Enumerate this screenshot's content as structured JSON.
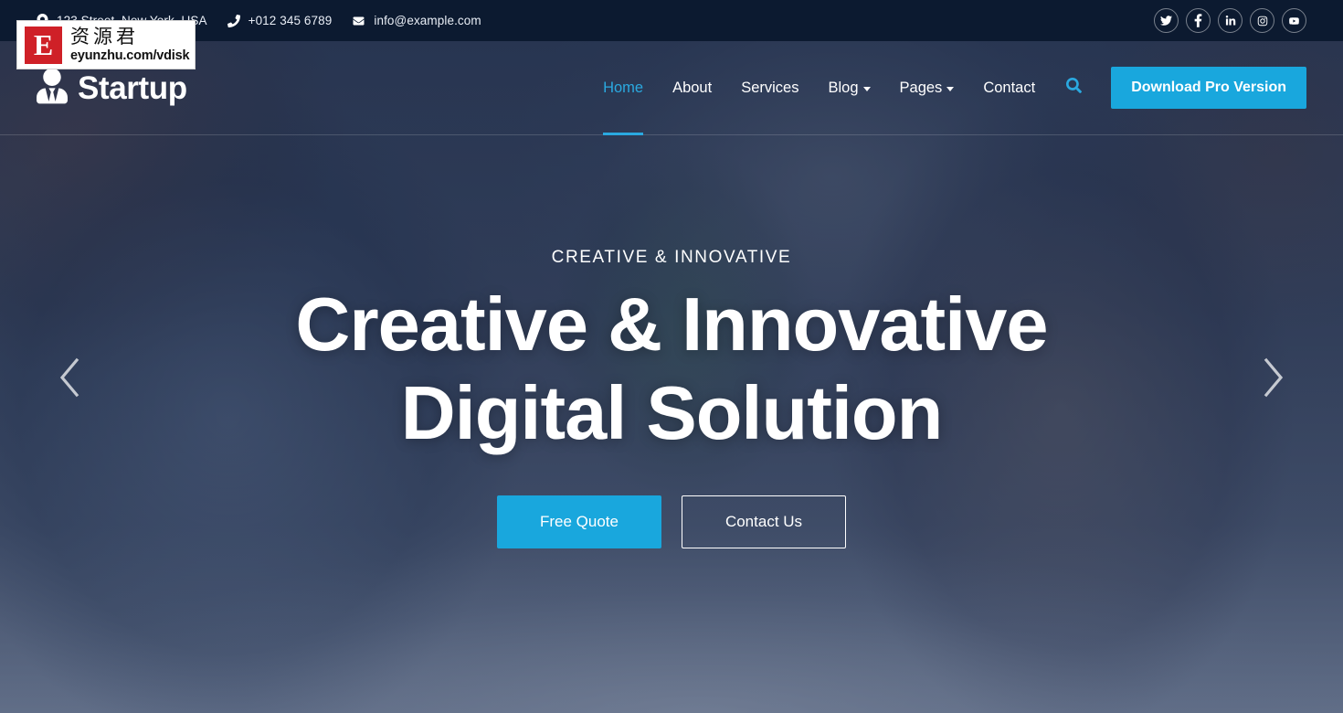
{
  "topbar": {
    "address": "123 Street, New York, USA",
    "phone": "+012 345 6789",
    "email": "info@example.com",
    "icons": {
      "address": "map-marker-icon",
      "phone": "phone-icon",
      "email": "envelope-icon"
    },
    "social": [
      {
        "name": "twitter",
        "label": "Twitter"
      },
      {
        "name": "facebook",
        "label": "Facebook"
      },
      {
        "name": "linkedin",
        "label": "LinkedIn"
      },
      {
        "name": "instagram",
        "label": "Instagram"
      },
      {
        "name": "youtube",
        "label": "YouTube"
      }
    ],
    "background_color": "#0c1a30"
  },
  "navbar": {
    "brand": "Startup",
    "brand_icon": "user-tie-icon",
    "links": [
      {
        "label": "Home",
        "active": true,
        "dropdown": false
      },
      {
        "label": "About",
        "active": false,
        "dropdown": false
      },
      {
        "label": "Services",
        "active": false,
        "dropdown": false
      },
      {
        "label": "Blog",
        "active": false,
        "dropdown": true
      },
      {
        "label": "Pages",
        "active": false,
        "dropdown": true
      },
      {
        "label": "Contact",
        "active": false,
        "dropdown": false
      }
    ],
    "search_icon": "search-icon",
    "cta_label": "Download Pro Version",
    "accent_color": "#19a7dd",
    "active_color": "#2aa9e0"
  },
  "hero": {
    "subtitle": "CREATIVE & INNOVATIVE",
    "title_line1": "Creative & Innovative",
    "title_line2": "Digital Solution",
    "primary_button": "Free Quote",
    "secondary_button": "Contact Us",
    "prev_icon": "chevron-left-icon",
    "next_icon": "chevron-right-icon",
    "overlay_color": "#14234 2"
  },
  "watermark": {
    "badge_letter": "E",
    "chinese": "资源君",
    "url": "eyunzhu.com/vdisk"
  }
}
